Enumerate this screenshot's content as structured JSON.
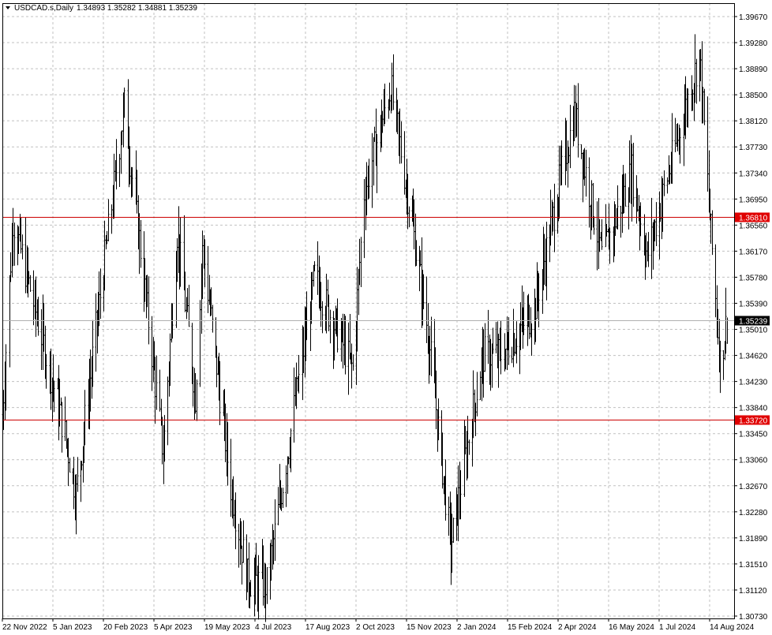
{
  "header": {
    "symbol": "USDCAD.s,Daily",
    "ohlc": "1.34893 1.35282 1.34881 1.35239"
  },
  "colors": {
    "background": "#ffffff",
    "grid": "#c0c0c0",
    "bars": "#000000",
    "level_line": "#cc0000",
    "level_label_bg": "#e00000",
    "price_label_bg": "#000000"
  },
  "chart_data": {
    "type": "ohlc-bar",
    "symbol": "USDCAD.s",
    "timeframe": "Daily",
    "grid": true,
    "price_axis": "right",
    "ylim": [
      1.3073,
      1.3987
    ],
    "y_ticks": [
      "1.39670",
      "1.39280",
      "1.38890",
      "1.38500",
      "1.38120",
      "1.37730",
      "1.37340",
      "1.36950",
      "1.36560",
      "1.36170",
      "1.35780",
      "1.35390",
      "1.35010",
      "1.34620",
      "1.34230",
      "1.33840",
      "1.33450",
      "1.33060",
      "1.32670",
      "1.32280",
      "1.31890",
      "1.31510",
      "1.31120",
      "1.30730"
    ],
    "x_ticks": [
      "22 Nov 2022",
      "5 Jan 2023",
      "20 Feb 2023",
      "5 Apr 2023",
      "19 May 2023",
      "4 Jul 2023",
      "17 Aug 2023",
      "2 Oct 2023",
      "15 Nov 2023",
      "2 Jan 2024",
      "15 Feb 2024",
      "2 Apr 2024",
      "16 May 2024",
      "1 Jul 2024",
      "14 Aug 2024"
    ],
    "horizontal_levels": [
      {
        "value": 1.3681,
        "label": "1.36810"
      },
      {
        "value": 1.3372,
        "label": "1.33720"
      }
    ],
    "current_price": {
      "value": 1.35239,
      "label": "1.35239"
    },
    "swing_points": [
      {
        "date": "22 Nov 2022",
        "price": 1.338
      },
      {
        "date": "1 Dec 2022",
        "price": 1.368
      },
      {
        "date": "16 Jan 2023",
        "price": 1.335
      },
      {
        "date": "26 Jan 2023",
        "price": 1.326
      },
      {
        "date": "10 Mar 2023",
        "price": 1.385
      },
      {
        "date": "13 Apr 2023",
        "price": 1.332
      },
      {
        "date": "25 Apr 2023",
        "price": 1.366
      },
      {
        "date": "11 May 2023",
        "price": 1.341
      },
      {
        "date": "17 May 2023",
        "price": 1.364
      },
      {
        "date": "12 Jun 2023",
        "price": 1.327
      },
      {
        "date": "27 Jun 2023",
        "price": 1.313
      },
      {
        "date": "14 Jul 2023",
        "price": 1.312
      },
      {
        "date": "25 Aug 2023",
        "price": 1.359
      },
      {
        "date": "29 Sep 2023",
        "price": 1.345
      },
      {
        "date": "9 Oct 2023",
        "price": 1.372
      },
      {
        "date": "1 Nov 2023",
        "price": 1.388
      },
      {
        "date": "5 Dec 2023",
        "price": 1.351
      },
      {
        "date": "27 Dec 2023",
        "price": 1.318
      },
      {
        "date": "24 Jan 2024",
        "price": 1.347
      },
      {
        "date": "8 Feb 2024",
        "price": 1.347
      },
      {
        "date": "11 Mar 2024",
        "price": 1.354
      },
      {
        "date": "16 Apr 2024",
        "price": 1.384
      },
      {
        "date": "10 May 2024",
        "price": 1.362
      },
      {
        "date": "6 Jun 2024",
        "price": 1.375
      },
      {
        "date": "20 Jun 2024",
        "price": 1.362
      },
      {
        "date": "5 Aug 2024",
        "price": 1.393
      },
      {
        "date": "14 Aug 2024",
        "price": 1.368
      },
      {
        "date": "23 Aug 2024",
        "price": 1.346
      },
      {
        "date": "29 Aug 2024",
        "price": 1.3524
      }
    ]
  }
}
